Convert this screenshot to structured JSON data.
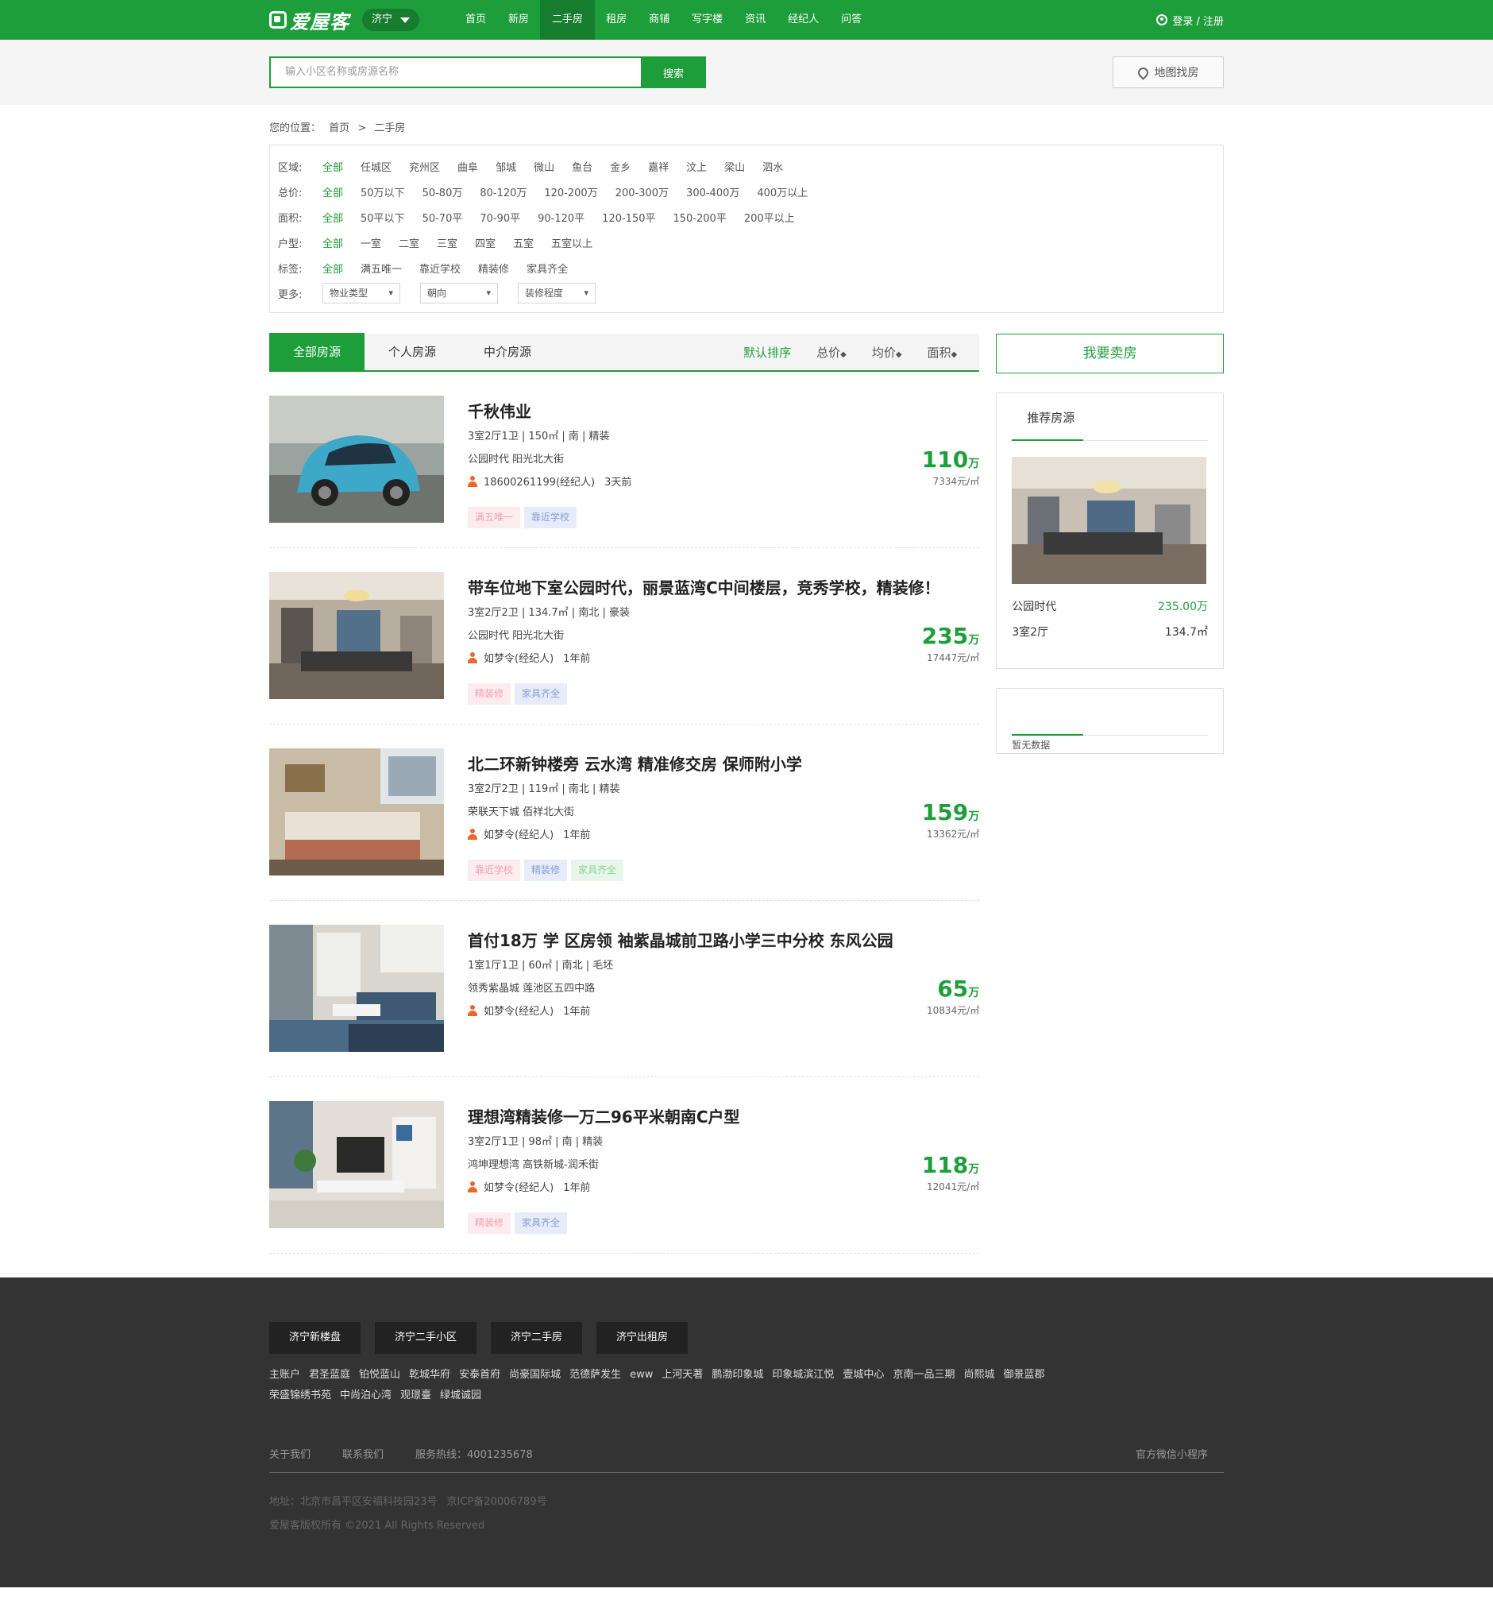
{
  "header": {
    "logo_text": "爱屋客",
    "city": "济宁",
    "nav": [
      "首页",
      "新房",
      "二手房",
      "租房",
      "商铺",
      "写字楼",
      "资讯",
      "经纪人",
      "问答"
    ],
    "active_nav": "二手房",
    "login": "登录 / 注册",
    "brand_color": "#1e9e3a"
  },
  "search": {
    "placeholder": "输入小区名称或房源名称",
    "button": "搜索",
    "map_button": "地图找房"
  },
  "breadcrumb": {
    "prefix": "您的位置：",
    "home": "首页",
    "sep": ">",
    "current": "二手房"
  },
  "filters": {
    "area": {
      "label": "区域:",
      "options": [
        "全部",
        "任城区",
        "兖州区",
        "曲阜",
        "邹城",
        "微山",
        "鱼台",
        "金乡",
        "嘉祥",
        "汶上",
        "梁山",
        "泗水"
      ]
    },
    "price": {
      "label": "总价:",
      "options": [
        "全部",
        "50万以下",
        "50-80万",
        "80-120万",
        "120-200万",
        "200-300万",
        "300-400万",
        "400万以上"
      ]
    },
    "size": {
      "label": "面积:",
      "options": [
        "全部",
        "50平以下",
        "50-70平",
        "70-90平",
        "90-120平",
        "120-150平",
        "150-200平",
        "200平以上"
      ]
    },
    "layout": {
      "label": "户型:",
      "options": [
        "全部",
        "一室",
        "二室",
        "三室",
        "四室",
        "五室",
        "五室以上"
      ]
    },
    "tag": {
      "label": "标签:",
      "options": [
        "全部",
        "满五唯一",
        "靠近学校",
        "精装修",
        "家具齐全"
      ]
    },
    "more": {
      "label": "更多:",
      "selects": [
        "物业类型",
        "朝向",
        "装修程度"
      ]
    }
  },
  "tabs": [
    "全部房源",
    "个人房源",
    "中介房源"
  ],
  "sorts": [
    "默认排序",
    "总价",
    "均价",
    "面积"
  ],
  "listings": [
    {
      "title": "千秋伟业",
      "info": "3室2厅1卫 | 150㎡ | 南 | 精装",
      "addr": "公园时代 阳光北大街",
      "agent": "18600261199(经纪人)",
      "time": "3天前",
      "tags": [
        {
          "t": "满五唯一",
          "c": "red"
        },
        {
          "t": "靠近学校",
          "c": "blue"
        }
      ],
      "price": "110",
      "unit": "万",
      "per": "7334元/㎡",
      "img": "car"
    },
    {
      "title": "带车位地下室公园时代，丽景蓝湾C中间楼层，竞秀学校，精装修！",
      "info": "3室2厅2卫 | 134.7㎡ | 南北 | 豪装",
      "addr": "公园时代 阳光北大街",
      "agent": "如梦令(经纪人)",
      "time": "1年前",
      "tags": [
        {
          "t": "精装修",
          "c": "red"
        },
        {
          "t": "家具齐全",
          "c": "blue"
        }
      ],
      "price": "235",
      "unit": "万",
      "per": "17447元/㎡",
      "img": "living"
    },
    {
      "title": "北二环新钟楼旁 云水湾 精准修交房 保师附小学",
      "info": "3室2厅2卫 | 119㎡ | 南北 | 精装",
      "addr": "荣联天下城 佰祥北大街",
      "agent": "如梦令(经纪人)",
      "time": "1年前",
      "tags": [
        {
          "t": "靠近学校",
          "c": "red"
        },
        {
          "t": "精装修",
          "c": "blue"
        },
        {
          "t": "家具齐全",
          "c": "green"
        }
      ],
      "price": "159",
      "unit": "万",
      "per": "13362元/㎡",
      "img": "bedroom"
    },
    {
      "title": "首付18万 学 区房领 袖紫晶城前卫路小学三中分校 东风公园",
      "info": "1室1厅1卫 | 60㎡ | 南北 | 毛坯",
      "addr": "领秀紫晶城 莲池区五四中路",
      "agent": "如梦令(经纪人)",
      "time": "1年前",
      "tags": [],
      "price": "65",
      "unit": "万",
      "per": "10834元/㎡",
      "img": "studio"
    },
    {
      "title": "理想湾精装修一万二96平米朝南C户型",
      "info": "3室2厅1卫 | 98㎡ | 南 | 精装",
      "addr": "鸿坤理想湾 高铁新城-润禾街",
      "agent": "如梦令(经纪人)",
      "time": "1年前",
      "tags": [
        {
          "t": "精装修",
          "c": "red"
        },
        {
          "t": "家具齐全",
          "c": "blue"
        }
      ],
      "price": "118",
      "unit": "万",
      "per": "12041元/㎡",
      "img": "tv"
    }
  ],
  "sidebar": {
    "sell_button": "我要卖房",
    "rec_title": "推荐房源",
    "rec_name": "公园时代",
    "rec_price": "235.00万",
    "rec_layout": "3室2厅",
    "rec_size": "134.7㎡",
    "empty_text": "暂无数据"
  },
  "footer": {
    "buttons": [
      "济宁新楼盘",
      "济宁二手小区",
      "济宁二手房",
      "济宁出租房"
    ],
    "links": [
      "主账户",
      "君圣蓝庭",
      "铂悦蓝山",
      "乾城华府",
      "安泰首府",
      "尚豪国际城",
      "范德萨发生",
      "eww",
      "上河天著",
      "鹏渤印象城",
      "印象城滨江悦",
      "壹城中心",
      "京南一品三期",
      "尚熙城",
      "御景蓝郡",
      "荣盛锦绣书苑",
      "中尚泊心湾",
      "观璟臺",
      "绿城诚园"
    ],
    "about": "关于我们",
    "contact": "联系我们",
    "hotline": "服务热线：4001235678",
    "mini": "官方微信小程序",
    "address": "地址：北京市昌平区安福科技园23号",
    "icp": "京ICP备20006789号",
    "copyright": "爱屋客版权所有 ©2021 All Rights Reserved"
  }
}
